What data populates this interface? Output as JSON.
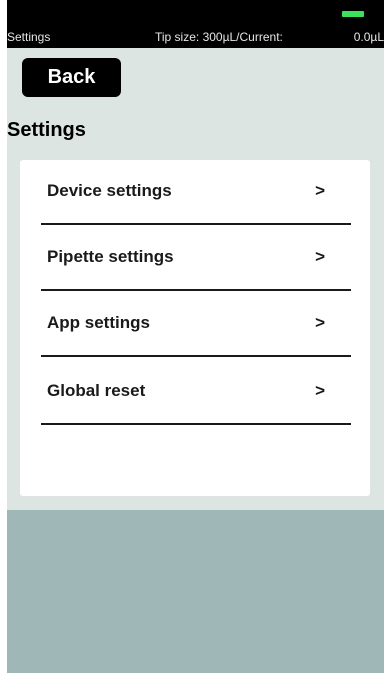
{
  "status_bar": {
    "screen_name": "Settings",
    "tip_size_text": "Tip size: 300µL/Current:",
    "current_value": "0.0µL",
    "battery_color": "#3de05a"
  },
  "header": {
    "back_label": "Back",
    "title": "Settings"
  },
  "menu": {
    "items": [
      {
        "label": "Device settings",
        "chevron": ">"
      },
      {
        "label": "Pipette settings",
        "chevron": ">"
      },
      {
        "label": "App settings",
        "chevron": ">"
      },
      {
        "label": "Global reset",
        "chevron": ">"
      }
    ]
  },
  "colors": {
    "background_top": "#dde5e2",
    "background_bottom": "#9fb8b7",
    "card": "#ffffff",
    "status_bar": "#000000"
  }
}
